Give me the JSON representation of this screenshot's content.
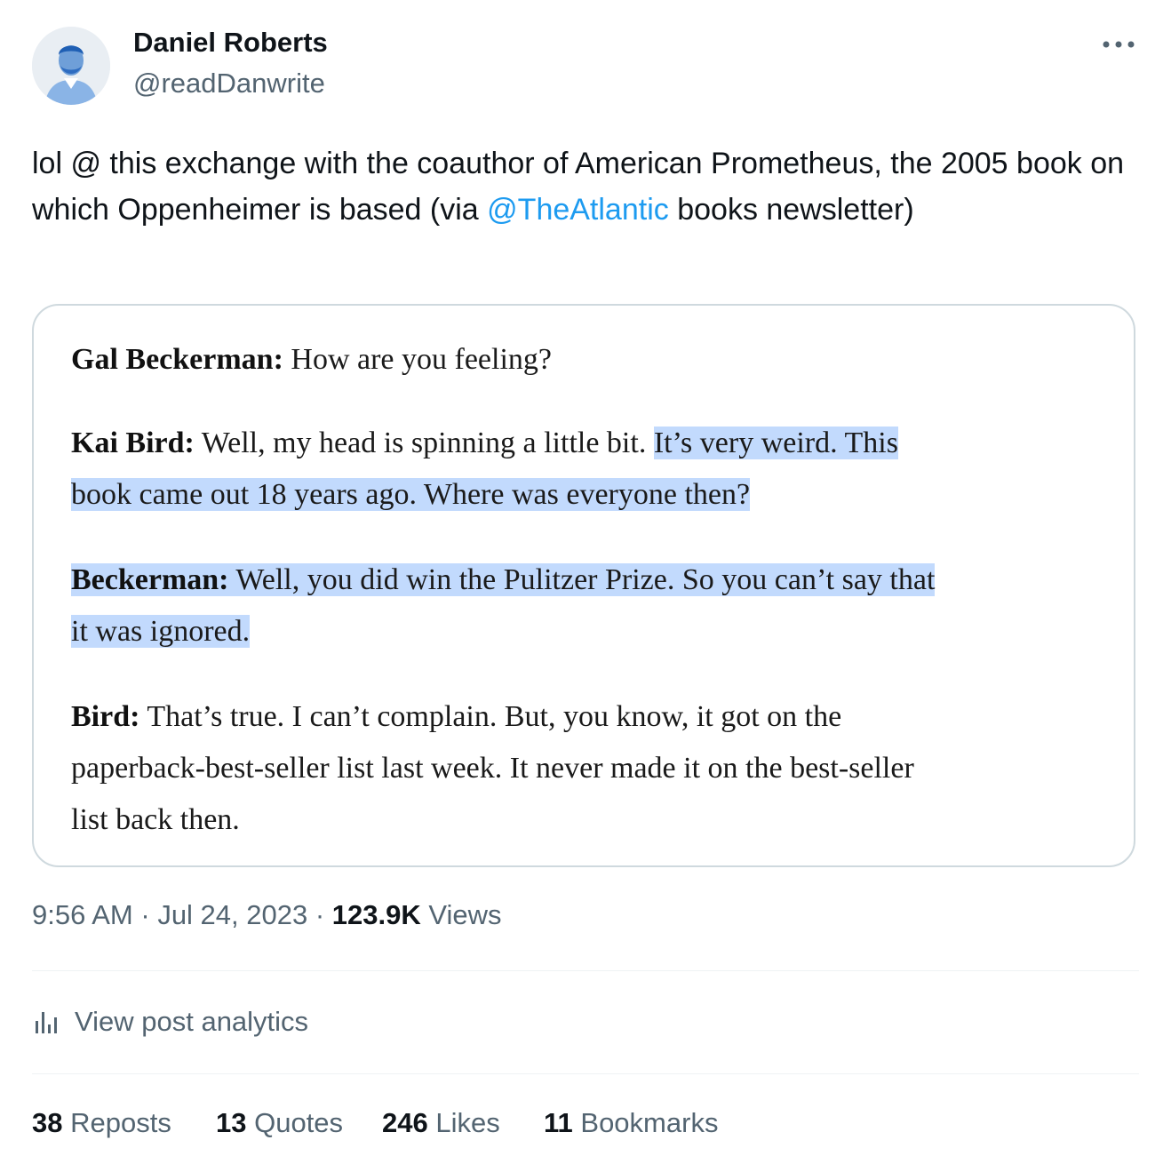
{
  "author": {
    "name": "Daniel Roberts",
    "handle": "@readDanwrite"
  },
  "tweet": {
    "text_before": "lol @ this exchange with the coauthor of American Prometheus, the 2005 book on which Oppenheimer is based (via ",
    "mention": "@TheAtlantic",
    "text_after": " books newsletter)"
  },
  "media": {
    "p1": {
      "speaker": "Gal Beckerman:",
      "text": " How are you feeling?"
    },
    "p2": {
      "speaker": "Kai Bird:",
      "text": " Well, my head is spinning a little bit. ",
      "highlighted_a": "It’s very weird. This",
      "highlighted_b": "book came out 18 years ago. Where was everyone then?"
    },
    "p3": {
      "speaker": "Beckerman:",
      "highlighted_a": " Well, you did win the Pulitzer Prize. So you can’t say that",
      "highlighted_b": "it was ignored."
    },
    "p4": {
      "speaker": "Bird:",
      "line1": " That’s true. I can’t complain. But, you know, it got on the",
      "line2": "paperback-best-seller list last week. It never made it on the best-seller",
      "line3": "list back then."
    }
  },
  "meta": {
    "time": "9:56 AM",
    "separator": " · ",
    "date": "Jul 24, 2023",
    "views_count": "123.9K",
    "views_label": " Views"
  },
  "analytics": {
    "icon": "analytics-icon",
    "label": "View post analytics"
  },
  "stats": {
    "reposts_count": "38",
    "reposts_label": " Reposts",
    "quotes_count": "13",
    "quotes_label": " Quotes",
    "likes_count": "246",
    "likes_label": " Likes",
    "bookmarks_count": "11",
    "bookmarks_label": " Bookmarks"
  },
  "colors": {
    "link": "#1d9bf0",
    "secondary_text": "#536471",
    "highlight": "#c2dafd",
    "border": "#cfd9de"
  }
}
